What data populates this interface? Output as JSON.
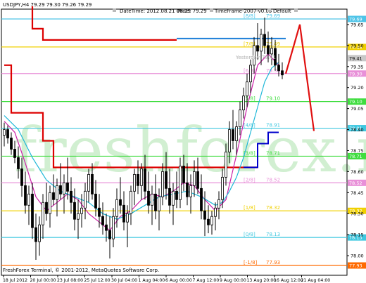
{
  "header": {
    "symbol_line": "USDJPY,H4  79.29 79.30 79.26 79.29",
    "date_time": "DateTime: 2012.08.21 08:29",
    "price": "Price: 79.29",
    "timeframe": "TimeFrame-2007-v0.05",
    "profile": "Default"
  },
  "footer": "FreshForex Terminal, © 2001-2012, MetaQuotes Software Corp.",
  "watermark": "freshforex.ru",
  "chart_data": {
    "type": "candlestick",
    "symbol": "USDJPY",
    "timeframe": "H4",
    "ylim": [
      77.86,
      79.76
    ],
    "x_tick_labels": [
      "18 Jul 2012",
      "20 Jul 00:00",
      "23 Jul 08:00",
      "25 Jul 12:00",
      "30 Jul 04:00",
      "1 Aug 04:00",
      "6 Aug 00:00",
      "7 Aug 12:00",
      "9 Aug 00:00",
      "13 Aug 20:00",
      "16 Aug 12:00",
      "21 Aug 04:00"
    ],
    "y_ticks": [
      79.65,
      79.5,
      79.35,
      79.2,
      79.05,
      78.9,
      78.75,
      78.6,
      78.45,
      78.3,
      78.15,
      78.0
    ],
    "levels": [
      {
        "value": 79.69,
        "label": "[8/8]",
        "axis_label": "79.69",
        "color": "#4fc4e8",
        "price_text": "79.69"
      },
      {
        "value": 79.49,
        "label": "[7/8]",
        "axis_label": "79.49",
        "color": "#f0d000",
        "price_text": "79.49"
      },
      {
        "value": 79.3,
        "label": "[6/8]",
        "axis_label": "79.30",
        "color": "#e890d8",
        "price_text": "79.30"
      },
      {
        "value": 79.1,
        "label": "[5/8]",
        "axis_label": "79.10",
        "color": "#40dd40",
        "price_text": "79.10"
      },
      {
        "value": 78.91,
        "label": "[4/8]",
        "axis_label": "78.91",
        "color": "#40c8e0",
        "price_text": "78.91"
      },
      {
        "value": 78.71,
        "label": "[3/8]",
        "axis_label": "78.71",
        "color": "#40dd40",
        "price_text": "78.71"
      },
      {
        "value": 78.52,
        "label": "[2/8]",
        "axis_label": "78.52",
        "color": "#e890d8",
        "price_text": "78.52"
      },
      {
        "value": 78.32,
        "label": "[1/8]",
        "axis_label": "78.32",
        "color": "#f0d000",
        "price_text": "78.32"
      },
      {
        "value": 78.13,
        "label": "[0/8]",
        "axis_label": "78.13",
        "color": "#40c8e0",
        "price_text": "78.13"
      },
      {
        "value": 77.93,
        "label": "[-1/8]",
        "axis_label": "77.93",
        "color": "#ff6a00",
        "price_text": "77.93"
      }
    ],
    "yesterday_label": "Yesterday",
    "yesterday_value": "79.41",
    "current_price": 79.41,
    "candles": [
      [
        78.86,
        78.95,
        78.78,
        78.9
      ],
      [
        78.9,
        78.93,
        78.8,
        78.84
      ],
      [
        78.84,
        78.88,
        78.72,
        78.76
      ],
      [
        78.76,
        78.82,
        78.66,
        78.7
      ],
      [
        78.7,
        78.78,
        78.55,
        78.62
      ],
      [
        78.62,
        78.7,
        78.42,
        78.5
      ],
      [
        78.5,
        78.6,
        78.3,
        78.36
      ],
      [
        78.36,
        78.5,
        78.22,
        78.44
      ],
      [
        78.44,
        78.52,
        78.12,
        78.2
      ],
      [
        78.2,
        78.3,
        77.97,
        78.1
      ],
      [
        78.1,
        78.28,
        78.0,
        78.22
      ],
      [
        78.22,
        78.44,
        78.12,
        78.38
      ],
      [
        78.38,
        78.52,
        78.25,
        78.3
      ],
      [
        78.3,
        78.5,
        78.2,
        78.45
      ],
      [
        78.45,
        78.58,
        78.36,
        78.4
      ],
      [
        78.4,
        78.55,
        78.28,
        78.5
      ],
      [
        78.5,
        78.66,
        78.4,
        78.44
      ],
      [
        78.44,
        78.58,
        78.3,
        78.52
      ],
      [
        78.52,
        78.7,
        78.4,
        78.46
      ],
      [
        78.46,
        78.56,
        78.3,
        78.38
      ],
      [
        78.38,
        78.48,
        78.18,
        78.26
      ],
      [
        78.26,
        78.4,
        78.12,
        78.3
      ],
      [
        78.3,
        78.44,
        78.2,
        78.34
      ],
      [
        78.34,
        78.52,
        78.26,
        78.46
      ],
      [
        78.46,
        78.62,
        78.38,
        78.58
      ],
      [
        78.58,
        78.66,
        78.4,
        78.44
      ],
      [
        78.44,
        78.54,
        78.28,
        78.34
      ],
      [
        78.34,
        78.44,
        78.2,
        78.28
      ],
      [
        78.28,
        78.38,
        78.15,
        78.22
      ],
      [
        78.22,
        78.3,
        78.1,
        78.18
      ],
      [
        78.18,
        78.28,
        77.98,
        78.12
      ],
      [
        78.12,
        78.34,
        78.06,
        78.28
      ],
      [
        78.28,
        78.48,
        78.2,
        78.4
      ],
      [
        78.4,
        78.56,
        78.3,
        78.36
      ],
      [
        78.36,
        78.46,
        78.18,
        78.24
      ],
      [
        78.24,
        78.36,
        78.06,
        78.3
      ],
      [
        78.3,
        78.5,
        78.22,
        78.46
      ],
      [
        78.46,
        78.62,
        78.36,
        78.58
      ],
      [
        78.58,
        78.68,
        78.44,
        78.5
      ],
      [
        78.5,
        78.66,
        78.4,
        78.62
      ],
      [
        78.62,
        78.72,
        78.4,
        78.46
      ],
      [
        78.46,
        78.6,
        78.3,
        78.36
      ],
      [
        78.36,
        78.5,
        78.22,
        78.44
      ],
      [
        78.44,
        78.58,
        78.26,
        78.32
      ],
      [
        78.32,
        78.48,
        78.18,
        78.42
      ],
      [
        78.42,
        78.66,
        78.36,
        78.6
      ],
      [
        78.6,
        78.74,
        78.4,
        78.48
      ],
      [
        78.48,
        78.62,
        78.3,
        78.36
      ],
      [
        78.36,
        78.52,
        78.22,
        78.46
      ],
      [
        78.46,
        78.6,
        78.34,
        78.4
      ],
      [
        78.4,
        78.7,
        78.34,
        78.64
      ],
      [
        78.64,
        78.72,
        78.46,
        78.52
      ],
      [
        78.52,
        78.66,
        78.36,
        78.42
      ],
      [
        78.42,
        78.58,
        78.3,
        78.5
      ],
      [
        78.5,
        78.68,
        78.42,
        78.6
      ],
      [
        78.6,
        78.7,
        78.44,
        78.48
      ],
      [
        78.48,
        78.58,
        78.26,
        78.32
      ],
      [
        78.32,
        78.46,
        78.14,
        78.26
      ],
      [
        78.26,
        78.36,
        78.16,
        78.22
      ],
      [
        78.22,
        78.32,
        78.15,
        78.28
      ],
      [
        78.28,
        78.38,
        78.18,
        78.34
      ],
      [
        78.34,
        78.46,
        78.26,
        78.4
      ],
      [
        78.4,
        78.62,
        78.34,
        78.56
      ],
      [
        78.56,
        78.8,
        78.5,
        78.74
      ],
      [
        78.74,
        78.96,
        78.66,
        78.9
      ],
      [
        78.9,
        79.04,
        78.76,
        78.82
      ],
      [
        78.82,
        78.96,
        78.72,
        78.92
      ],
      [
        78.92,
        79.1,
        78.86,
        79.04
      ],
      [
        79.04,
        79.2,
        78.98,
        79.14
      ],
      [
        79.14,
        79.3,
        79.06,
        79.24
      ],
      [
        79.24,
        79.4,
        79.16,
        79.36
      ],
      [
        79.36,
        79.56,
        79.3,
        79.5
      ],
      [
        79.5,
        79.66,
        79.4,
        79.46
      ],
      [
        79.46,
        79.62,
        79.36,
        79.58
      ],
      [
        79.58,
        79.7,
        79.44,
        79.5
      ],
      [
        79.5,
        79.6,
        79.38,
        79.44
      ],
      [
        79.44,
        79.56,
        79.36,
        79.48
      ],
      [
        79.48,
        79.54,
        79.32,
        79.36
      ],
      [
        79.36,
        79.44,
        79.28,
        79.32
      ],
      [
        79.32,
        79.38,
        79.26,
        79.29
      ]
    ],
    "lines": [
      {
        "name": "red-step",
        "color": "#dd0000",
        "width": 2.2,
        "points": [
          [
            0,
            79.36
          ],
          [
            2,
            79.36
          ],
          [
            2,
            79.02
          ],
          [
            11,
            79.02
          ],
          [
            11,
            78.82
          ],
          [
            14,
            78.82
          ],
          [
            14,
            78.63
          ],
          [
            51,
            78.63
          ],
          [
            51,
            78.63
          ],
          [
            72,
            78.63
          ]
        ]
      },
      {
        "name": "red-step-upper",
        "color": "#dd0000",
        "width": 2.2,
        "points": [
          [
            8,
            79.78
          ],
          [
            8,
            79.62
          ],
          [
            11,
            79.62
          ],
          [
            11,
            79.54
          ],
          [
            49,
            79.54
          ]
        ]
      },
      {
        "name": "blue-upper",
        "color": "#1e7fd8",
        "width": 2,
        "points": [
          [
            49,
            79.55
          ],
          [
            80,
            79.55
          ]
        ]
      },
      {
        "name": "blue-step",
        "color": "#0000cc",
        "width": 2,
        "points": [
          [
            68,
            78.63
          ],
          [
            72,
            78.63
          ],
          [
            72,
            78.8
          ],
          [
            75,
            78.8
          ],
          [
            75,
            78.88
          ],
          [
            78,
            78.88
          ]
        ]
      },
      {
        "name": "magenta",
        "color": "#cc1fa8",
        "width": 1.2,
        "points": [
          [
            0,
            78.96
          ],
          [
            3,
            78.88
          ],
          [
            6,
            78.66
          ],
          [
            9,
            78.42
          ],
          [
            12,
            78.32
          ],
          [
            15,
            78.38
          ],
          [
            18,
            78.44
          ],
          [
            21,
            78.4
          ],
          [
            24,
            78.3
          ],
          [
            27,
            78.24
          ],
          [
            30,
            78.18
          ],
          [
            33,
            78.28
          ],
          [
            36,
            78.32
          ],
          [
            39,
            78.4
          ],
          [
            42,
            78.44
          ],
          [
            45,
            78.42
          ],
          [
            48,
            78.46
          ],
          [
            51,
            78.52
          ],
          [
            54,
            78.5
          ],
          [
            57,
            78.4
          ],
          [
            60,
            78.32
          ],
          [
            63,
            78.4
          ],
          [
            66,
            78.72
          ],
          [
            69,
            79.06
          ],
          [
            72,
            79.36
          ],
          [
            75,
            79.44
          ],
          [
            78,
            79.36
          ]
        ]
      },
      {
        "name": "cyan",
        "color": "#20b8d8",
        "width": 1.2,
        "points": [
          [
            0,
            79.0
          ],
          [
            4,
            78.9
          ],
          [
            8,
            78.7
          ],
          [
            12,
            78.54
          ],
          [
            16,
            78.46
          ],
          [
            20,
            78.42
          ],
          [
            24,
            78.38
          ],
          [
            28,
            78.3
          ],
          [
            32,
            78.26
          ],
          [
            36,
            78.3
          ],
          [
            40,
            78.36
          ],
          [
            44,
            78.42
          ],
          [
            48,
            78.44
          ],
          [
            52,
            78.46
          ],
          [
            56,
            78.42
          ],
          [
            60,
            78.36
          ],
          [
            62,
            78.38
          ],
          [
            64,
            78.46
          ],
          [
            66,
            78.56
          ],
          [
            68,
            78.7
          ],
          [
            70,
            78.88
          ],
          [
            72,
            79.06
          ],
          [
            74,
            79.24
          ],
          [
            76,
            79.34
          ],
          [
            78,
            79.38
          ]
        ]
      },
      {
        "name": "forecast",
        "color": "#e01010",
        "width": 2.2,
        "points": [
          [
            80,
            79.3
          ],
          [
            84,
            79.65
          ],
          [
            88,
            78.89
          ]
        ]
      }
    ]
  }
}
